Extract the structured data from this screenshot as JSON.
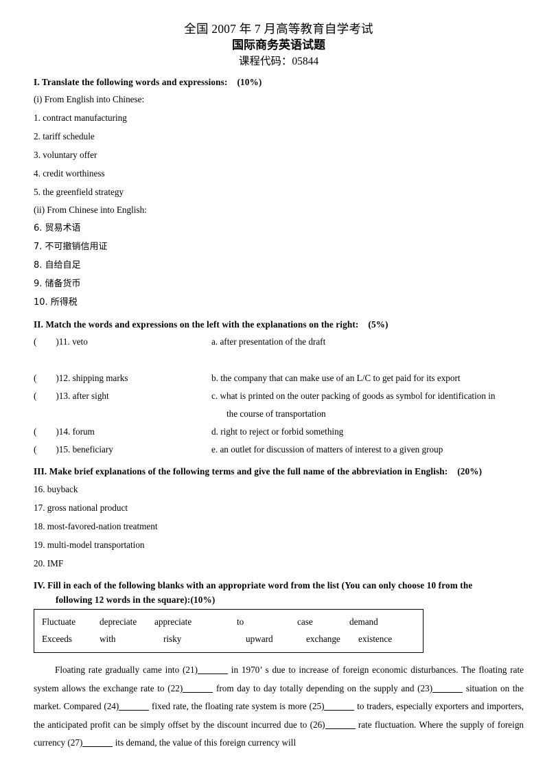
{
  "document": {
    "title_line_1": "全国 2007 年 7 月高等教育自学考试",
    "title_line_2": "国际商务英语试题",
    "title_line_3": "课程代码：05844"
  },
  "section_1": {
    "heading": "I. Translate the following words and expressions:",
    "marks": "(10%)",
    "sub_heading_1": "(i) From English into Chinese:",
    "items_en": [
      "1. contract manufacturing",
      "2. tariff schedule",
      "3. voluntary offer",
      "4. credit worthiness",
      "5. the greenfield strategy"
    ],
    "sub_heading_2": "(ii) From Chinese into English:",
    "items_cn": [
      "6. 贸易术语",
      "7. 不可撤销信用证",
      "8. 自给自足",
      "9. 储备货币",
      "10. 所得税"
    ]
  },
  "section_2": {
    "heading": "II. Match the words and expressions on the left with the explanations on the right:",
    "marks": "(5%)",
    "pairs": [
      {
        "left_open": "(",
        "left_close": ")11. veto",
        "right": "a. after presentation of the draft",
        "right_wrap": ""
      },
      {
        "left_open": "(",
        "left_close": ")12. shipping marks",
        "right": "b. the company that can make use of an L/C to get paid for its export",
        "right_wrap": ""
      },
      {
        "left_open": "(",
        "left_close": ")13. after sight",
        "right": "c. what is printed on the outer packing of goods as symbol for identification in",
        "right_wrap": "the course of transportation"
      },
      {
        "left_open": "(",
        "left_close": ")14. forum",
        "right": "d. right to reject or forbid something",
        "right_wrap": ""
      },
      {
        "left_open": "(",
        "left_close": ")15. beneficiary",
        "right": "e. an outlet for discussion of matters of interest to a given group",
        "right_wrap": ""
      }
    ]
  },
  "section_3": {
    "heading": "III. Make brief explanations of the following terms and give the full name of the abbreviation in English:",
    "marks": "(20%)",
    "items": [
      "16. buyback",
      "17. gross national product",
      "18. most-favored-nation treatment",
      "19. multi-model transportation",
      "20. IMF"
    ]
  },
  "section_4": {
    "heading_line_1": "IV. Fill in each of the following blanks with an appropriate word from the list (You can only choose 10 from the",
    "heading_line_2": "following 12 words in the square):",
    "marks": "(10%)",
    "word_box": {
      "row_1": [
        "Fluctuate",
        "depreciate",
        "appreciate",
        "to",
        "case",
        "demand"
      ],
      "row_2": [
        "Exceeds",
        "with",
        "risky",
        "upward",
        "exchange",
        "existence"
      ]
    },
    "paragraph": {
      "p1": "Floating rate gradually came into (21)",
      "p2": "in 1970’ s due to increase of foreign economic disturbances. The floating rate system allows the exchange rate to (22)",
      "p3": "from day to day totally depending on the supply and (23)",
      "p4": "situation on the market. Compared (24)",
      "p5": "fixed rate, the floating rate system is more (25)",
      "p6": "to traders, especially exporters and importers, the anticipated profit can be simply offset by the discount incurred due to (26)",
      "p7": "rate fluctuation. Where the supply of foreign currency (27)",
      "p8": "its demand, the value of this foreign currency will"
    }
  }
}
